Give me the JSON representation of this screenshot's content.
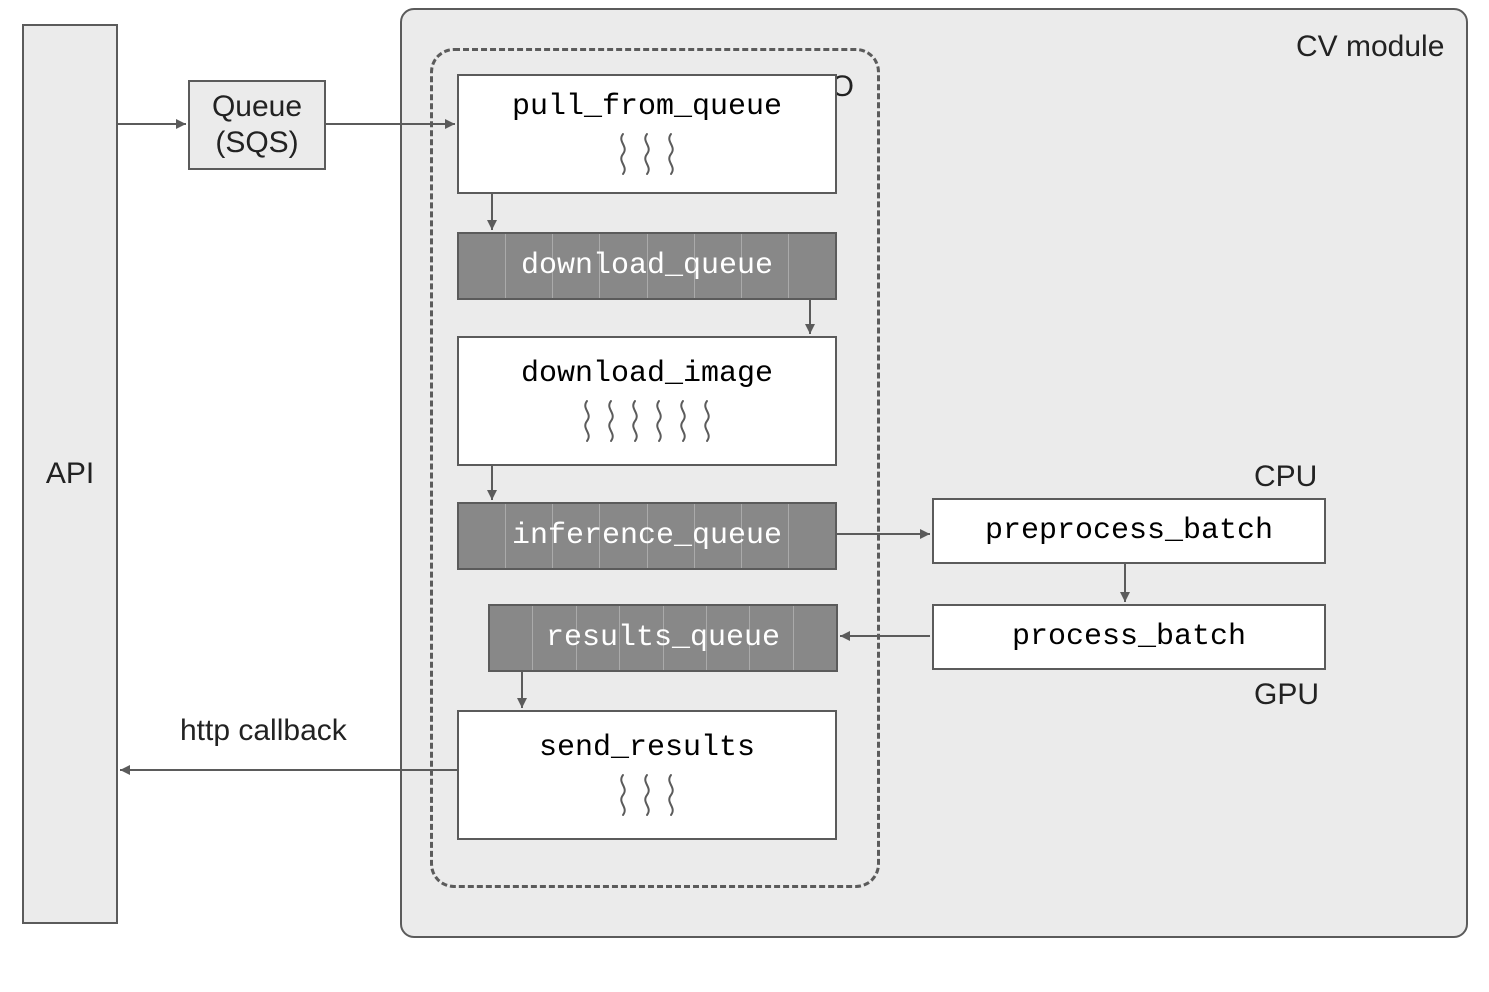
{
  "api": {
    "label": "API"
  },
  "queue": {
    "line1": "Queue",
    "line2": "(SQS)"
  },
  "cv_module": {
    "title": "CV module"
  },
  "io_group": {
    "title": "I/O"
  },
  "cpu": {
    "title": "CPU"
  },
  "gpu": {
    "title": "GPU"
  },
  "callback_label": "http callback",
  "steps": {
    "pull_from_queue": {
      "label": "pull_from_queue",
      "threads": 3
    },
    "download_queue": {
      "label": "download_queue",
      "segments": 8
    },
    "download_image": {
      "label": "download_image",
      "threads": 6
    },
    "inference_queue": {
      "label": "inference_queue",
      "segments": 8
    },
    "results_queue": {
      "label": "results_queue",
      "segments": 8
    },
    "send_results": {
      "label": "send_results",
      "threads": 3
    },
    "preprocess_batch": {
      "label": "preprocess_batch"
    },
    "process_batch": {
      "label": "process_batch"
    }
  },
  "flow": [
    "API -> Queue (SQS)",
    "Queue (SQS) -> pull_from_queue",
    "pull_from_queue -> download_queue",
    "download_queue -> download_image",
    "download_image -> inference_queue",
    "inference_queue -> preprocess_batch",
    "preprocess_batch -> process_batch",
    "process_batch -> results_queue",
    "results_queue -> send_results",
    "send_results -> API (http callback)"
  ]
}
